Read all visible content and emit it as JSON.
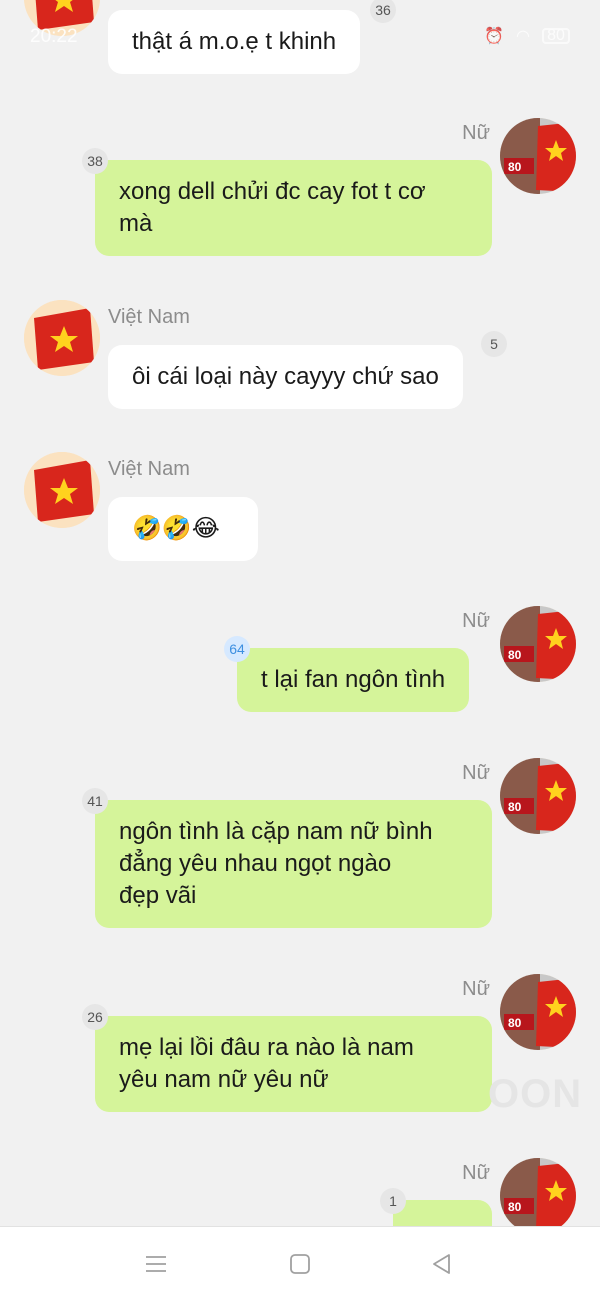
{
  "status_bar": {
    "time": "20:22",
    "battery": "80"
  },
  "messages": [
    {
      "sender": "",
      "text": "thật á m.o.ẹ t khinh",
      "badge": "36"
    },
    {
      "sender": "Nữ",
      "text": "xong dell chửi đc cay fot t cơ\nmà",
      "badge": "38"
    },
    {
      "sender": "Việt Nam",
      "text": "ôi cái loại này cayyy chứ sao",
      "badge": "5"
    },
    {
      "sender": "Việt Nam",
      "text": "🤣🤣😂",
      "badge": ""
    },
    {
      "sender": "Nữ",
      "text": "t lại fan ngôn tình",
      "badge": "64"
    },
    {
      "sender": "Nữ",
      "text": "ngôn tình là cặp nam nữ bình\nđẳng yêu nhau ngọt ngào\nđẹp vãi",
      "badge": "41"
    },
    {
      "sender": "Nữ",
      "text": "mẹ lại lồi đâu ra nào là nam\nyêu nam nữ yêu nữ",
      "badge": "26"
    },
    {
      "sender": "Nữ",
      "text": "",
      "badge": "1"
    }
  ],
  "avatar_text": "80",
  "watermark": "OON",
  "icons": {
    "menu": "menu-icon",
    "home": "home-icon",
    "back": "back-icon"
  },
  "colors": {
    "background": "#f1f1f1",
    "incoming_bubble": "#ffffff",
    "outgoing_bubble": "#d5f49a",
    "name": "#8c8c8c",
    "badge_blue": "#3d8fe0"
  }
}
